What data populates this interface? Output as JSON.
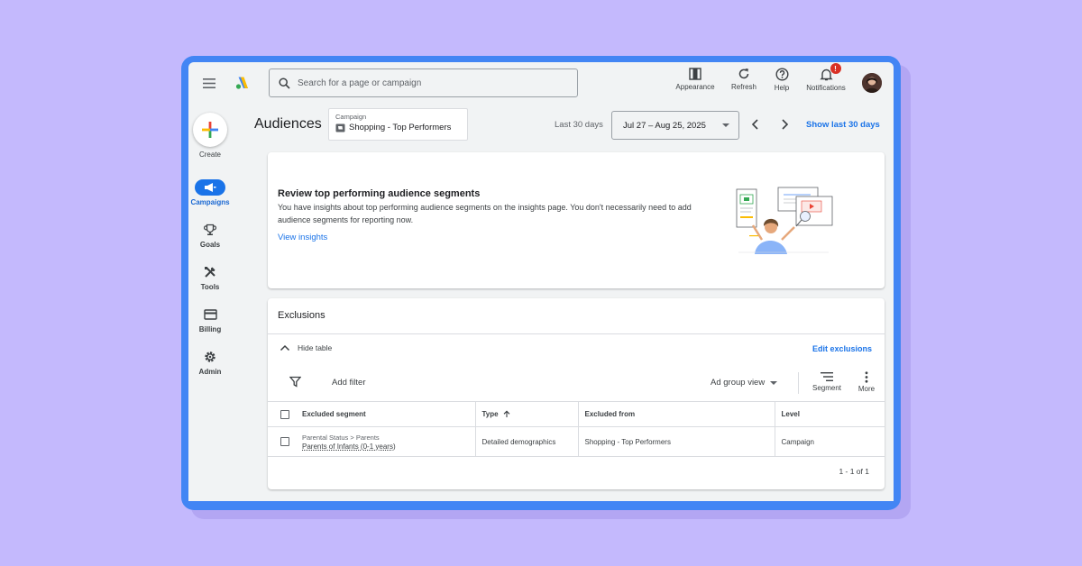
{
  "topbar": {
    "search_placeholder": "Search for a page or campaign",
    "actions": [
      {
        "label": "Appearance",
        "icon": "appearance-icon"
      },
      {
        "label": "Refresh",
        "icon": "refresh-icon"
      },
      {
        "label": "Help",
        "icon": "help-icon"
      },
      {
        "label": "Notifications",
        "icon": "bell-icon"
      }
    ],
    "notification_count": "!"
  },
  "sidebar": {
    "create_label": "Create",
    "items": [
      {
        "label": "Campaigns",
        "icon": "megaphone-icon",
        "active": true
      },
      {
        "label": "Goals",
        "icon": "trophy-icon",
        "active": false
      },
      {
        "label": "Tools",
        "icon": "tools-icon",
        "active": false
      },
      {
        "label": "Billing",
        "icon": "credit-card-icon",
        "active": false
      },
      {
        "label": "Admin",
        "icon": "gear-icon",
        "active": false
      }
    ]
  },
  "header": {
    "title": "Audiences",
    "campaign_small": "Campaign",
    "campaign_name": "Shopping - Top Performers",
    "range_label": "Last 30 days",
    "date_range": "Jul 27 – Aug 25, 2025",
    "show_last": "Show last 30 days"
  },
  "insight": {
    "title": "Review top performing audience segments",
    "body": "You have insights about top performing audience segments on the insights page. You don't necessarily need to add audience segments for reporting now.",
    "link": "View insights"
  },
  "exclusions": {
    "title": "Exclusions",
    "hide_table": "Hide table",
    "edit": "Edit exclusions",
    "add_filter": "Add filter",
    "view": "Ad group view",
    "segment_label": "Segment",
    "more_label": "More",
    "columns": [
      "Excluded segment",
      "Type",
      "Excluded from",
      "Level"
    ],
    "rows": [
      {
        "segment_path": "Parental Status > Parents",
        "segment": "Parents of Infants (0-1 years)",
        "type": "Detailed demographics",
        "excluded_from": "Shopping - Top Performers",
        "level": "Campaign"
      }
    ],
    "pagination": "1 - 1 of 1"
  },
  "colors": {
    "background": "#c4b9fd",
    "frame": "#4285f4",
    "accent": "#1a73e8",
    "badge": "#d93025"
  }
}
